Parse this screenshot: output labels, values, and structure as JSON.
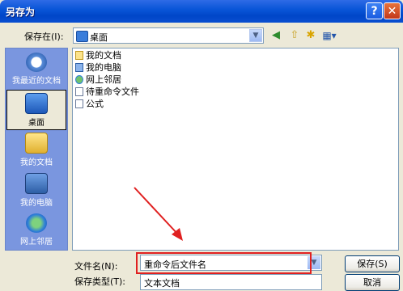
{
  "window": {
    "title": "另存为"
  },
  "save_in": {
    "label": "保存在(I):",
    "value": "桌面",
    "value_icon": "desktop-icon"
  },
  "toolbar": {
    "icons": [
      "back-icon",
      "up-folder-icon",
      "new-folder-icon",
      "views-menu-icon"
    ]
  },
  "places": [
    {
      "label": "我最近的文档",
      "icon": "recent-documents-icon"
    },
    {
      "label": "桌面",
      "icon": "desktop-icon",
      "selected": true
    },
    {
      "label": "我的文档",
      "icon": "my-documents-icon"
    },
    {
      "label": "我的电脑",
      "icon": "my-computer-icon"
    },
    {
      "label": "网上邻居",
      "icon": "network-places-icon"
    }
  ],
  "files": [
    {
      "name": "我的文档",
      "icon": "folder-icon"
    },
    {
      "name": "我的电脑",
      "icon": "computer-icon"
    },
    {
      "name": "网上邻居",
      "icon": "network-icon"
    },
    {
      "name": "待重命令文件",
      "icon": "file-icon"
    },
    {
      "name": "公式",
      "icon": "file-icon"
    }
  ],
  "filename": {
    "label": "文件名(N):",
    "value": "重命令后文件名"
  },
  "filetype": {
    "label": "保存类型(T):",
    "value": "文本文档"
  },
  "buttons": {
    "save": "保存(S)",
    "cancel": "取消"
  },
  "colors": {
    "annotation": "#E02020",
    "titlebar": "#0A56D8",
    "places_bar": "#7A96DF"
  }
}
